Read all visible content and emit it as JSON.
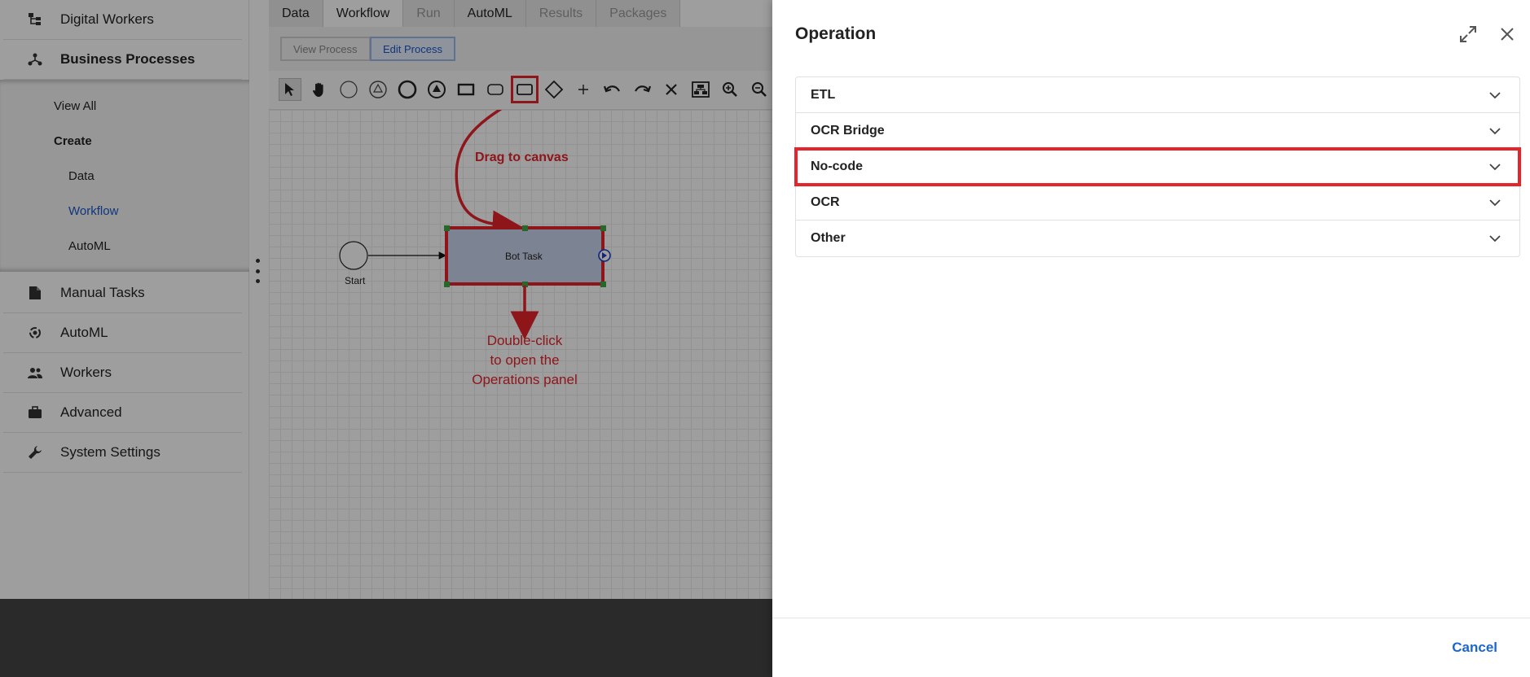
{
  "sidebar": {
    "items": [
      {
        "label": "Digital Workers",
        "icon": "hierarchy-icon"
      },
      {
        "label": "Business Processes",
        "icon": "network-icon"
      },
      {
        "label": "Manual Tasks",
        "icon": "document-icon"
      },
      {
        "label": "AutoML",
        "icon": "automl-icon"
      },
      {
        "label": "Workers",
        "icon": "people-icon"
      },
      {
        "label": "Advanced",
        "icon": "briefcase-icon"
      },
      {
        "label": "System Settings",
        "icon": "wrench-icon"
      }
    ],
    "submenu": {
      "view_all": "View All",
      "create": "Create",
      "data": "Data",
      "workflow": "Workflow",
      "automl": "AutoML"
    }
  },
  "editor": {
    "tabs": [
      "Data",
      "Workflow",
      "Run",
      "AutoML",
      "Results",
      "Packages"
    ],
    "active_tab": "Workflow",
    "disabled_tabs": [
      "Run",
      "Results",
      "Packages"
    ],
    "view_process": "View Process",
    "edit_process": "Edit Process",
    "canvas": {
      "start_label": "Start",
      "task_label": "Bot Task",
      "annotation_drag": "Drag to canvas",
      "annotation_dblclick": [
        "Double-click",
        "to open the",
        "Operations panel"
      ]
    }
  },
  "dialog": {
    "title": "Operation",
    "operations": [
      "ETL",
      "OCR Bridge",
      "No-code",
      "OCR",
      "Other"
    ],
    "highlighted": "No-code",
    "cancel_label": "Cancel"
  },
  "colors": {
    "accent": "#1a66d2",
    "annotation": "#e5242c",
    "active_nav": "#1a56c8"
  }
}
